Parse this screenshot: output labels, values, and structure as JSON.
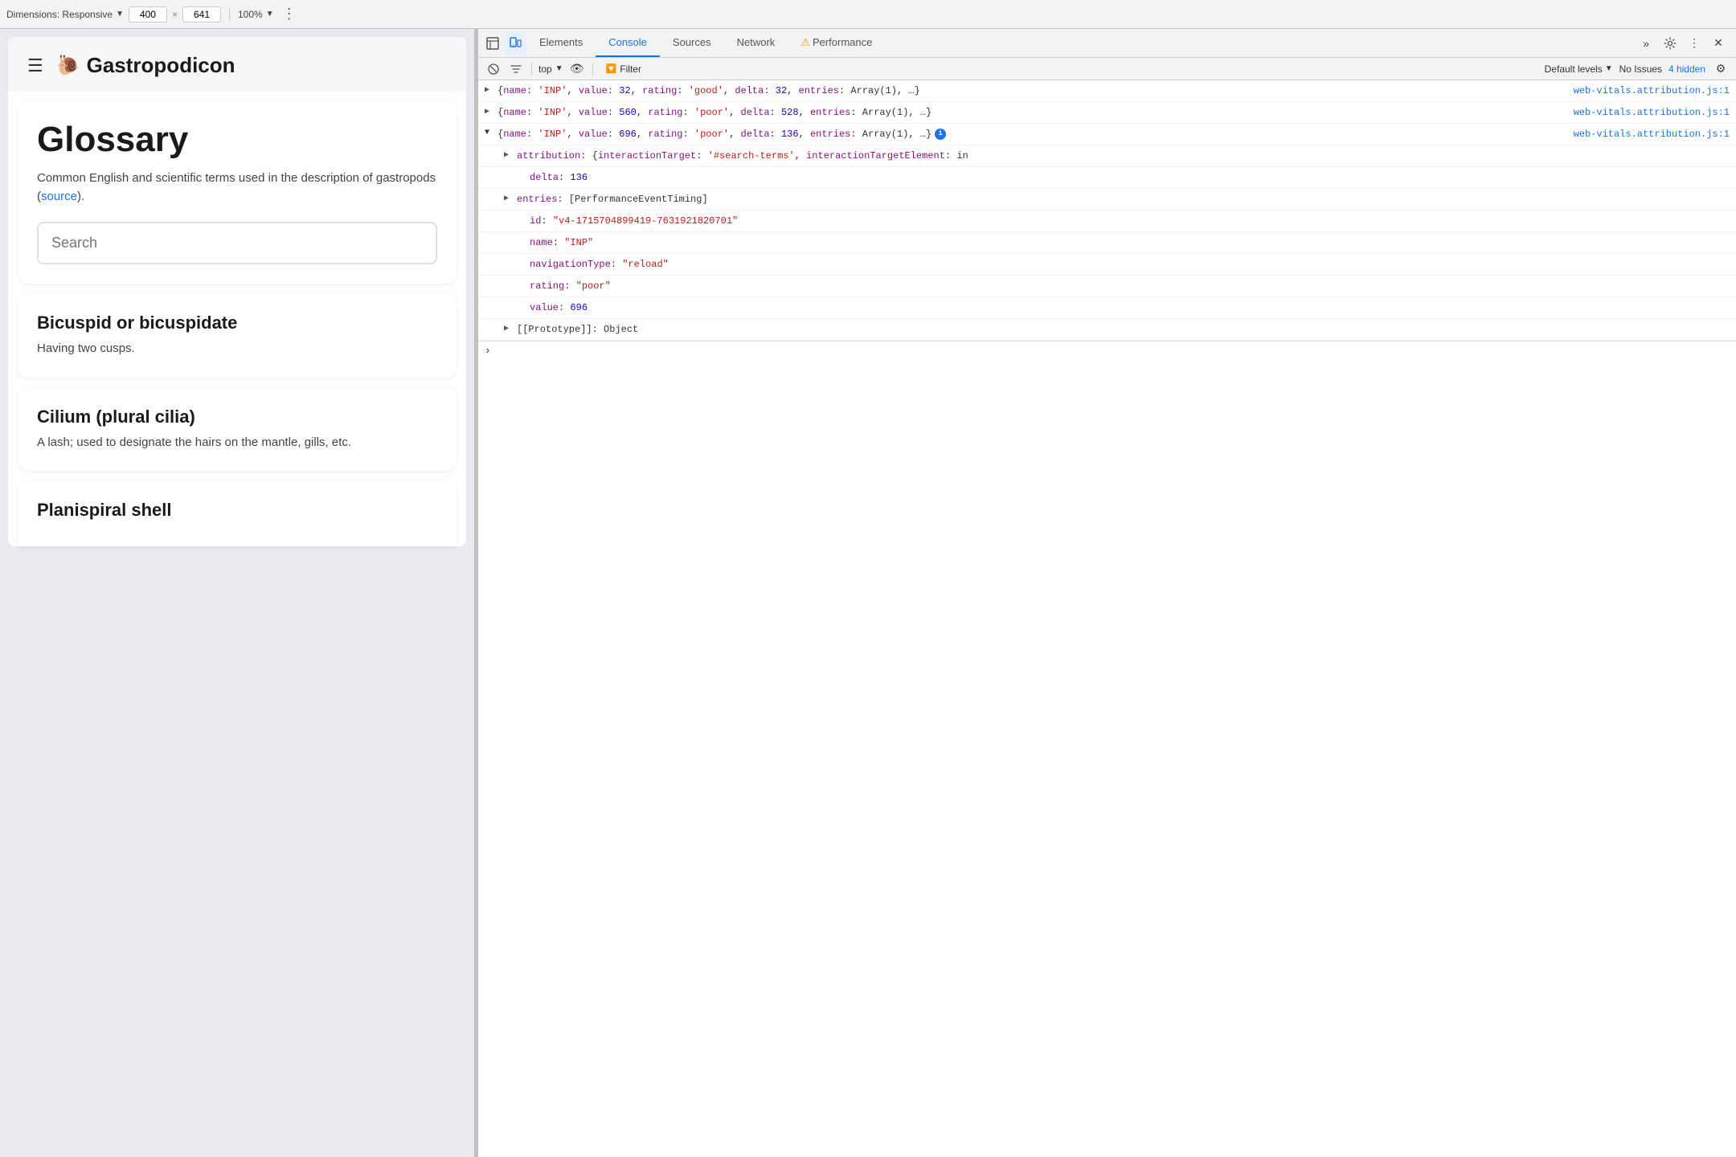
{
  "toolbar": {
    "dimensions_label": "Dimensions: Responsive",
    "width_value": "400",
    "height_value": "641",
    "zoom_value": "100%",
    "more_icon": "⋮"
  },
  "devtools": {
    "tabs": [
      {
        "label": "Elements",
        "active": false
      },
      {
        "label": "Console",
        "active": true
      },
      {
        "label": "Sources",
        "active": false
      },
      {
        "label": "Network",
        "active": false
      },
      {
        "label": "⚠ Performance",
        "active": false
      }
    ],
    "toolbar2": {
      "context": "top",
      "filter_label": "Filter",
      "levels_label": "Default levels",
      "no_issues": "No Issues",
      "hidden_count": "4 hidden"
    },
    "console": {
      "rows": [
        {
          "id": "row1",
          "type": "collapsed",
          "link": "web-vitals.attribution.js:1",
          "content": "{name: 'INP', value: 32, rating: 'good', delta: 32, entries: Array(1), …}"
        },
        {
          "id": "row2",
          "type": "collapsed",
          "link": "web-vitals.attribution.js:1",
          "content": "{name: 'INP', value: 560, rating: 'poor', delta: 528, entries: Array(1), …}"
        },
        {
          "id": "row3",
          "type": "expanded",
          "link": "web-vitals.attribution.js:1",
          "content": "{name: 'INP', value: 696, rating: 'poor', delta: 136, entries: Array(1), …}",
          "has_info": true,
          "children": [
            {
              "indent": 1,
              "key": "attribution",
              "value": "{interactionTarget: '#search-terms', interactionTargetElement: in",
              "expandable": true
            },
            {
              "indent": 2,
              "key": "delta",
              "value": "136",
              "expandable": false
            },
            {
              "indent": 1,
              "key": "entries",
              "value": "[PerformanceEventTiming]",
              "expandable": true
            },
            {
              "indent": 2,
              "key": "id",
              "value": "\"v4-1715704899419-7631921820701\"",
              "expandable": false
            },
            {
              "indent": 2,
              "key": "name",
              "value": "\"INP\"",
              "expandable": false
            },
            {
              "indent": 2,
              "key": "navigationType",
              "value": "\"reload\"",
              "expandable": false
            },
            {
              "indent": 2,
              "key": "rating",
              "value": "\"poor\"",
              "expandable": false
            },
            {
              "indent": 2,
              "key": "value",
              "value": "696",
              "expandable": false
            },
            {
              "indent": 1,
              "key": "[[Prototype]]",
              "value": "Object",
              "expandable": true
            }
          ]
        }
      ]
    }
  },
  "website": {
    "header": {
      "logo_icon": "🐌",
      "title": "Gastropodicon"
    },
    "glossary": {
      "heading": "Glossary",
      "description_start": "Common English and scientific terms used in the description of gastropods (",
      "source_link": "source",
      "description_end": ").",
      "search_placeholder": "Search"
    },
    "terms": [
      {
        "title": "Bicuspid or bicuspidate",
        "definition": "Having two cusps."
      },
      {
        "title": "Cilium (plural cilia)",
        "definition": "A lash; used to designate the hairs on the mantle, gills, etc."
      },
      {
        "title": "Planispiral shell",
        "definition": ""
      }
    ]
  }
}
